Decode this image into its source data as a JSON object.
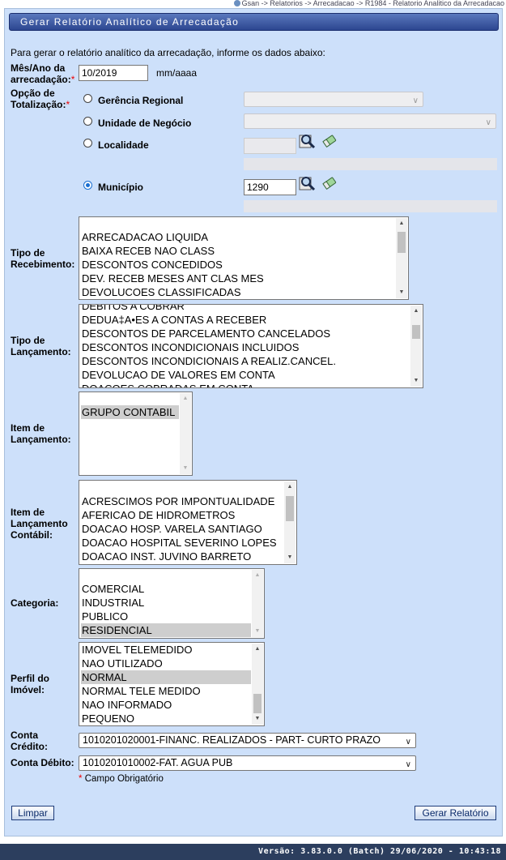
{
  "breadcrumb": "Gsan -> Relatorios -> Arrecadacao -> R1984 - Relatorio Analitico da Arrecadacao",
  "title": "Gerar Relatório Analítico de Arrecadação",
  "intro": "Para gerar o relatório analítico da arrecadação, informe os dados abaixo:",
  "required_mark": "*",
  "mes_ano": {
    "label_line1": "Mês/Ano da",
    "label_line2": "arrecadação:",
    "value": "10/2019",
    "hint": "mm/aaaa"
  },
  "totalizacao": {
    "label_line1": "Opção de",
    "label_line2": "Totalização:",
    "options": [
      {
        "label": "Gerência Regional",
        "selected": false
      },
      {
        "label": "Unidade de Negócio",
        "selected": false
      },
      {
        "label": "Localidade",
        "selected": false
      },
      {
        "label": "Município",
        "selected": true
      }
    ],
    "localidade_value": "",
    "municipio_value": "1290"
  },
  "tipo_recebimento": {
    "label_line1": "Tipo de",
    "label_line2": "Recebimento:",
    "items": [
      "",
      "ARRECADACAO LIQUIDA",
      "BAIXA RECEB NAO CLASS",
      "DESCONTOS CONCEDIDOS",
      "DEV. RECEB MESES ANT CLAS MES",
      "DEVOLUCOES CLASSIFICADAS"
    ]
  },
  "tipo_lancamento": {
    "label_line1": "Tipo de",
    "label_line2": "Lançamento:",
    "items": [
      "DEBITOS A COBRAR",
      "DEDUA‡A•ES A CONTAS A RECEBER",
      "DESCONTOS DE PARCELAMENTO CANCELADOS",
      "DESCONTOS INCONDICIONAIS INCLUIDOS",
      "DESCONTOS INCONDICIONAIS A REALIZ.CANCEL.",
      "DEVOLUCAO DE VALORES EM CONTA",
      "DOACOES COBRADAS EM CONTA"
    ]
  },
  "item_lancamento": {
    "label_line1": "Item de",
    "label_line2": "Lançamento:",
    "items": [
      "",
      "GRUPO CONTABIL"
    ]
  },
  "item_lancamento_contabil": {
    "label_line1": "Item de",
    "label_line2": "Lançamento",
    "label_line3": "Contábil:",
    "items": [
      "",
      "ACRESCIMOS POR IMPONTUALIDADE",
      "AFERICAO DE HIDROMETROS",
      "DOACAO HOSP. VARELA SANTIAGO",
      "DOACAO HOSPITAL SEVERINO LOPES",
      "DOACAO INST. JUVINO BARRETO"
    ]
  },
  "categoria": {
    "label": "Categoria:",
    "items": [
      "",
      "COMERCIAL",
      "INDUSTRIAL",
      "PUBLICO",
      "RESIDENCIAL"
    ]
  },
  "perfil_imovel": {
    "label_line1": "Perfil do",
    "label_line2": "Imóvel:",
    "items": [
      "IMOVEL TELEMEDIDO",
      "NAO UTILIZADO",
      "NORMAL",
      "NORMAL TELE MEDIDO",
      "NAO INFORMADO",
      "PEQUENO"
    ]
  },
  "conta_credito": {
    "label_line1": "Conta",
    "label_line2": "Crédito:",
    "value": "1010201020001-FINANC. REALIZADOS - PART- CURTO PRAZO"
  },
  "conta_debito": {
    "label": "Conta Débito:",
    "value": "1010201010002-FAT. AGUA PUB"
  },
  "campo_obrigatorio": "Campo Obrigatório",
  "buttons": {
    "limpar": "Limpar",
    "gerar": "Gerar Relatório"
  },
  "footer": "Versão: 3.83.0.0 (Batch) 29/06/2020 - 10:43:18",
  "colors": {
    "panel_bg": "#cde0fa",
    "title_bar": "#3a55a0",
    "required": "#ee0000",
    "footer_bg": "#2c3e5e"
  }
}
